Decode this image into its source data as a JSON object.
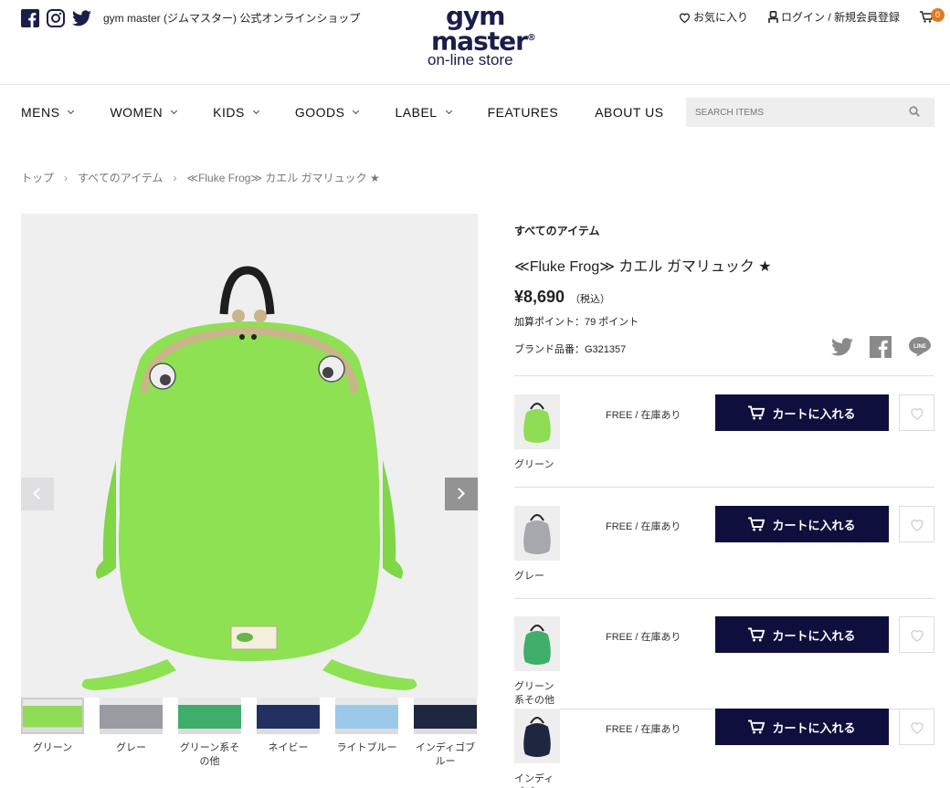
{
  "header": {
    "tagline": "gym master (ジムマスター) 公式オンラインショップ",
    "logo_line1": "gym",
    "logo_line2": "master",
    "logo_reg": "®",
    "logo_line3": "on-line store",
    "favorites_label": "お気に入り",
    "login_label": "ログイン / 新規会員登録",
    "cart_count": "0"
  },
  "nav": {
    "items": [
      "MENS",
      "WOMEN",
      "KIDS",
      "GOODS",
      "LABEL",
      "FEATURES",
      "ABOUT US"
    ],
    "search_placeholder": "SEARCH ITEMS"
  },
  "breadcrumb": [
    "トップ",
    "すべてのアイテム",
    "≪Fluke Frog≫ カエル ガマリュック ★"
  ],
  "gallery": {
    "thumbnails": [
      {
        "label": "グリーン",
        "color": "#8fdd55"
      },
      {
        "label": "グレー",
        "color": "#9a9aa3"
      },
      {
        "label": "グリーン系その他",
        "color": "#3fae6a"
      },
      {
        "label": "ネイビー",
        "color": "#223060"
      },
      {
        "label": "ライトブルー",
        "color": "#9cc8ea"
      },
      {
        "label": "インディゴブルー",
        "color": "#1f2640"
      }
    ]
  },
  "product": {
    "category": "すべてのアイテム",
    "title": "≪Fluke Frog≫ カエル ガマリュック ★",
    "price": "¥8,690",
    "tax_label": "（税込）",
    "points": "加算ポイント：79 ポイント",
    "brand_code": "ブランド品番：G321357",
    "variants": [
      {
        "label": "グリーン",
        "stock": "FREE / 在庫あり",
        "color": "#8fdd55"
      },
      {
        "label": "グレー",
        "stock": "FREE / 在庫あり",
        "color": "#a7a7ae"
      },
      {
        "label": "グリーン系その他",
        "stock": "FREE / 在庫あり",
        "color": "#3fae6a"
      },
      {
        "label": "インディゴブルー",
        "stock": "FREE / 在庫あり",
        "color": "#1f2640"
      }
    ],
    "cart_button_label": "カートに入れる"
  }
}
